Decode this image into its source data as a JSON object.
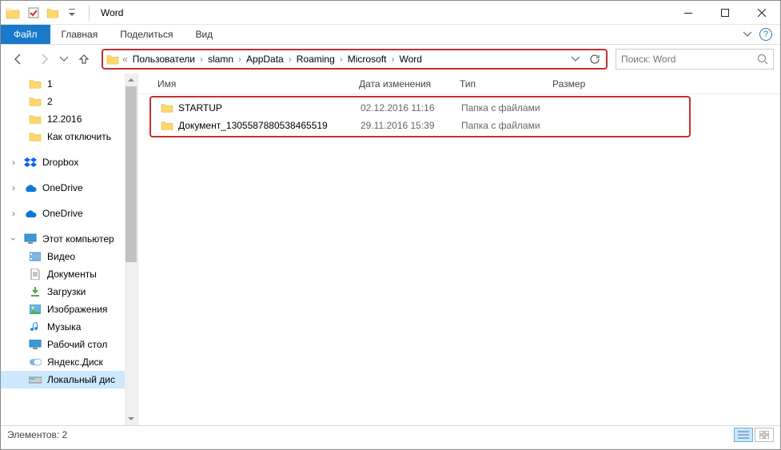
{
  "title": "Word",
  "ribbon": {
    "file": "Файл",
    "tabs": [
      "Главная",
      "Поделиться",
      "Вид"
    ]
  },
  "breadcrumbs": [
    "Пользователи",
    "slamn",
    "AppData",
    "Roaming",
    "Microsoft",
    "Word"
  ],
  "breadcrumb_prefix": "«",
  "search": {
    "placeholder": "Поиск: Word"
  },
  "columns": {
    "name": "Имя",
    "date": "Дата изменения",
    "type": "Тип",
    "size": "Размер"
  },
  "tree": {
    "quick": [
      {
        "label": "1"
      },
      {
        "label": "2"
      },
      {
        "label": "12.2016"
      },
      {
        "label": "Как отключить"
      }
    ],
    "dropbox": "Dropbox",
    "onedrive1": "OneDrive",
    "onedrive2": "OneDrive",
    "thispc": "Этот компьютер",
    "pcitems": [
      {
        "label": "Видео"
      },
      {
        "label": "Документы"
      },
      {
        "label": "Загрузки"
      },
      {
        "label": "Изображения"
      },
      {
        "label": "Музыка"
      },
      {
        "label": "Рабочий стол"
      },
      {
        "label": "Яндекс.Диск"
      },
      {
        "label": "Локальный дис"
      }
    ]
  },
  "files": [
    {
      "name": "STARTUP",
      "date": "02.12.2016 11:16",
      "type": "Папка с файлами"
    },
    {
      "name": "Документ_1305587880538465519",
      "date": "29.11.2016 15:39",
      "type": "Папка с файлами"
    }
  ],
  "status": "Элементов: 2"
}
